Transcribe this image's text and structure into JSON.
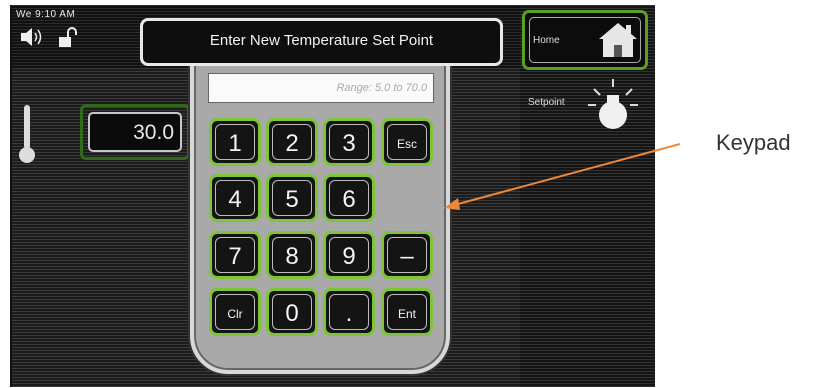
{
  "status": {
    "time": "We 9:10 AM"
  },
  "current": {
    "temperature": "30.0"
  },
  "dialog": {
    "title": "Enter New Temperature Set Point",
    "range_hint": "Range: 5.0 to 70.0"
  },
  "nav": {
    "home_label": "Home",
    "setpoint_label": "Setpoint"
  },
  "keys": {
    "k1": "1",
    "k2": "2",
    "k3": "3",
    "esc": "Esc",
    "k4": "4",
    "k5": "5",
    "k6": "6",
    "k7": "7",
    "k8": "8",
    "k9": "9",
    "minus": "–",
    "clr": "Clr",
    "k0": "0",
    "dot": ".",
    "ent": "Ent"
  },
  "annotation": {
    "label": "Keypad",
    "color": "#f0883a"
  },
  "colors": {
    "key_border": "#7dc43a",
    "home_border": "#5d9d2a"
  }
}
